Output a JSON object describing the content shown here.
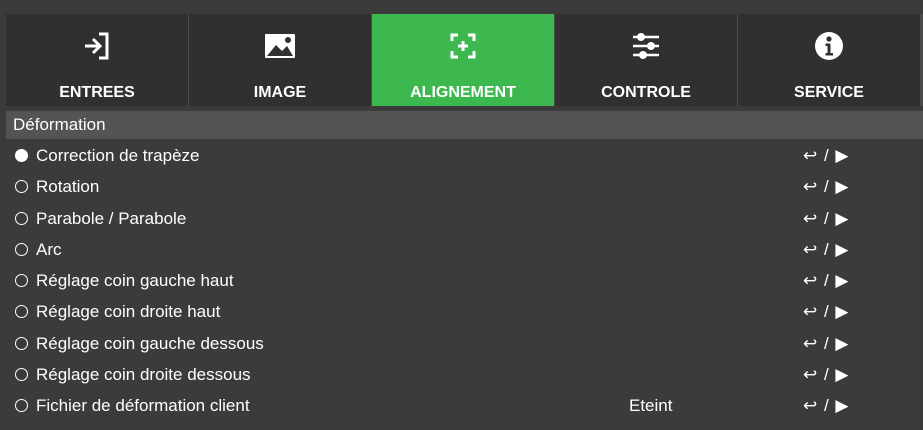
{
  "tabs": [
    {
      "label": "ENTREES",
      "icon": "input-icon",
      "active": false
    },
    {
      "label": "IMAGE",
      "icon": "image-icon",
      "active": false
    },
    {
      "label": "ALIGNEMENT",
      "icon": "alignment-icon",
      "active": true
    },
    {
      "label": "CONTROLE",
      "icon": "sliders-icon",
      "active": false
    },
    {
      "label": "SERVICE",
      "icon": "info-icon",
      "active": false
    }
  ],
  "section": {
    "title": "Déformation"
  },
  "items": [
    {
      "label": "Correction de trapèze",
      "selected": true,
      "value": "",
      "action": "↩ / ▶"
    },
    {
      "label": "Rotation",
      "selected": false,
      "value": "",
      "action": "↩ / ▶"
    },
    {
      "label": "Parabole / Parabole",
      "selected": false,
      "value": "",
      "action": "↩ / ▶"
    },
    {
      "label": "Arc",
      "selected": false,
      "value": "",
      "action": "↩ / ▶"
    },
    {
      "label": "Réglage coin gauche haut",
      "selected": false,
      "value": "",
      "action": "↩ / ▶"
    },
    {
      "label": "Réglage coin droite haut",
      "selected": false,
      "value": "",
      "action": "↩ / ▶"
    },
    {
      "label": "Réglage coin gauche dessous",
      "selected": false,
      "value": "",
      "action": "↩ / ▶"
    },
    {
      "label": "Réglage coin droite dessous",
      "selected": false,
      "value": "",
      "action": "↩ / ▶"
    },
    {
      "label": "Fichier de déformation client",
      "selected": false,
      "value": "Eteint",
      "action": "↩ / ▶"
    }
  ],
  "colors": {
    "active_tab": "#3cb84f",
    "tab_bg": "#303030",
    "page_bg": "#3b3b3b",
    "section_bg": "#545454"
  }
}
